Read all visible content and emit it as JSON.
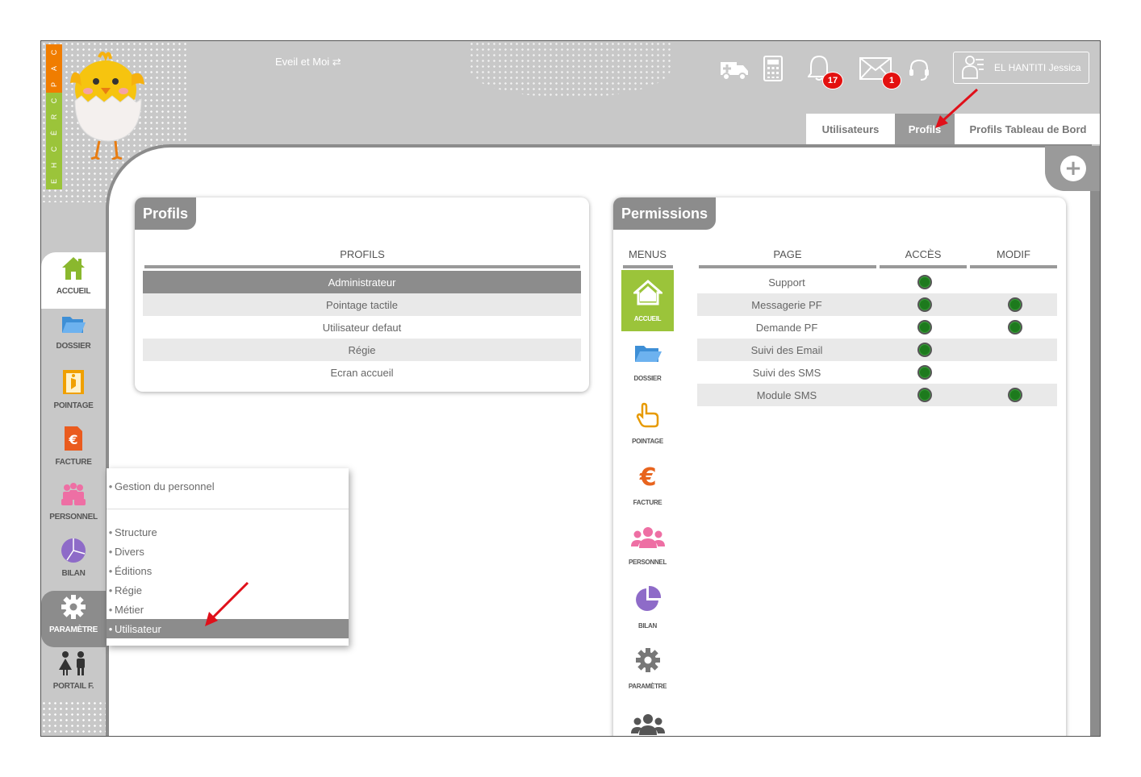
{
  "logo": {
    "letters": [
      "C",
      "A",
      "P",
      "C",
      "R",
      "È",
      "C",
      "H",
      "E"
    ]
  },
  "header": {
    "company_label": "Eveil et Moi ⇄",
    "notifications": {
      "bell_count": "17",
      "mail_count": "1"
    },
    "user_name": "EL HANTITI Jessica"
  },
  "tabs": [
    {
      "label": "Utilisateurs"
    },
    {
      "label": "Profils"
    },
    {
      "label": "Profils Tableau de Bord"
    }
  ],
  "nav": [
    {
      "label": "ACCUEIL",
      "icon": "home-icon"
    },
    {
      "label": "DOSSIER",
      "icon": "folder-icon"
    },
    {
      "label": "POINTAGE",
      "icon": "clock-door-icon"
    },
    {
      "label": "FACTURE",
      "icon": "invoice-icon"
    },
    {
      "label": "PERSONNEL",
      "icon": "staff-icon"
    },
    {
      "label": "BILAN",
      "icon": "pie-chart-icon"
    },
    {
      "label": "PARAMÈTRE",
      "icon": "gear-icon"
    },
    {
      "label": "PORTAIL F.",
      "icon": "family-icon"
    }
  ],
  "dropdown": {
    "top_item": "Gestion du personnel",
    "items": [
      "Structure",
      "Divers",
      "Éditions",
      "Régie",
      "Métier",
      "Utilisateur"
    ]
  },
  "profils_panel": {
    "title": "Profils",
    "column": "PROFILS",
    "rows": [
      "Administrateur",
      "Pointage tactile",
      "Utilisateur defaut",
      "Régie",
      "Ecran accueil"
    ]
  },
  "permissions_panel": {
    "title": "Permissions",
    "columns": {
      "menus": "MENUS",
      "page": "PAGE",
      "acces": "ACCÈS",
      "modif": "MODIF"
    },
    "menus": [
      {
        "label": "ACCUEIL",
        "icon": "home-icon"
      },
      {
        "label": "DOSSIER",
        "icon": "folder-icon"
      },
      {
        "label": "POINTAGE",
        "icon": "hand-pointer-icon"
      },
      {
        "label": "FACTURE",
        "icon": "euro-icon"
      },
      {
        "label": "PERSONNEL",
        "icon": "users-icon"
      },
      {
        "label": "BILAN",
        "icon": "pie-chart-icon"
      },
      {
        "label": "PARAMÈTRE",
        "icon": "gear-icon"
      },
      {
        "label": "",
        "icon": "users-icon"
      }
    ],
    "pages": [
      {
        "name": "Support",
        "acces": true,
        "modif": false
      },
      {
        "name": "Messagerie PF",
        "acces": true,
        "modif": true
      },
      {
        "name": "Demande PF",
        "acces": true,
        "modif": true
      },
      {
        "name": "Suivi des Email",
        "acces": true,
        "modif": false
      },
      {
        "name": "Suivi des SMS",
        "acces": true,
        "modif": false
      },
      {
        "name": "Module SMS",
        "acces": true,
        "modif": true
      }
    ]
  },
  "colors": {
    "accent_green": "#9bc43a",
    "accent_orange": "#f07d00",
    "frame_gray": "#c8c8c8",
    "active_gray": "#8c8c8c",
    "badge_red": "#e3100f",
    "status_green": "#1d7a1d"
  }
}
